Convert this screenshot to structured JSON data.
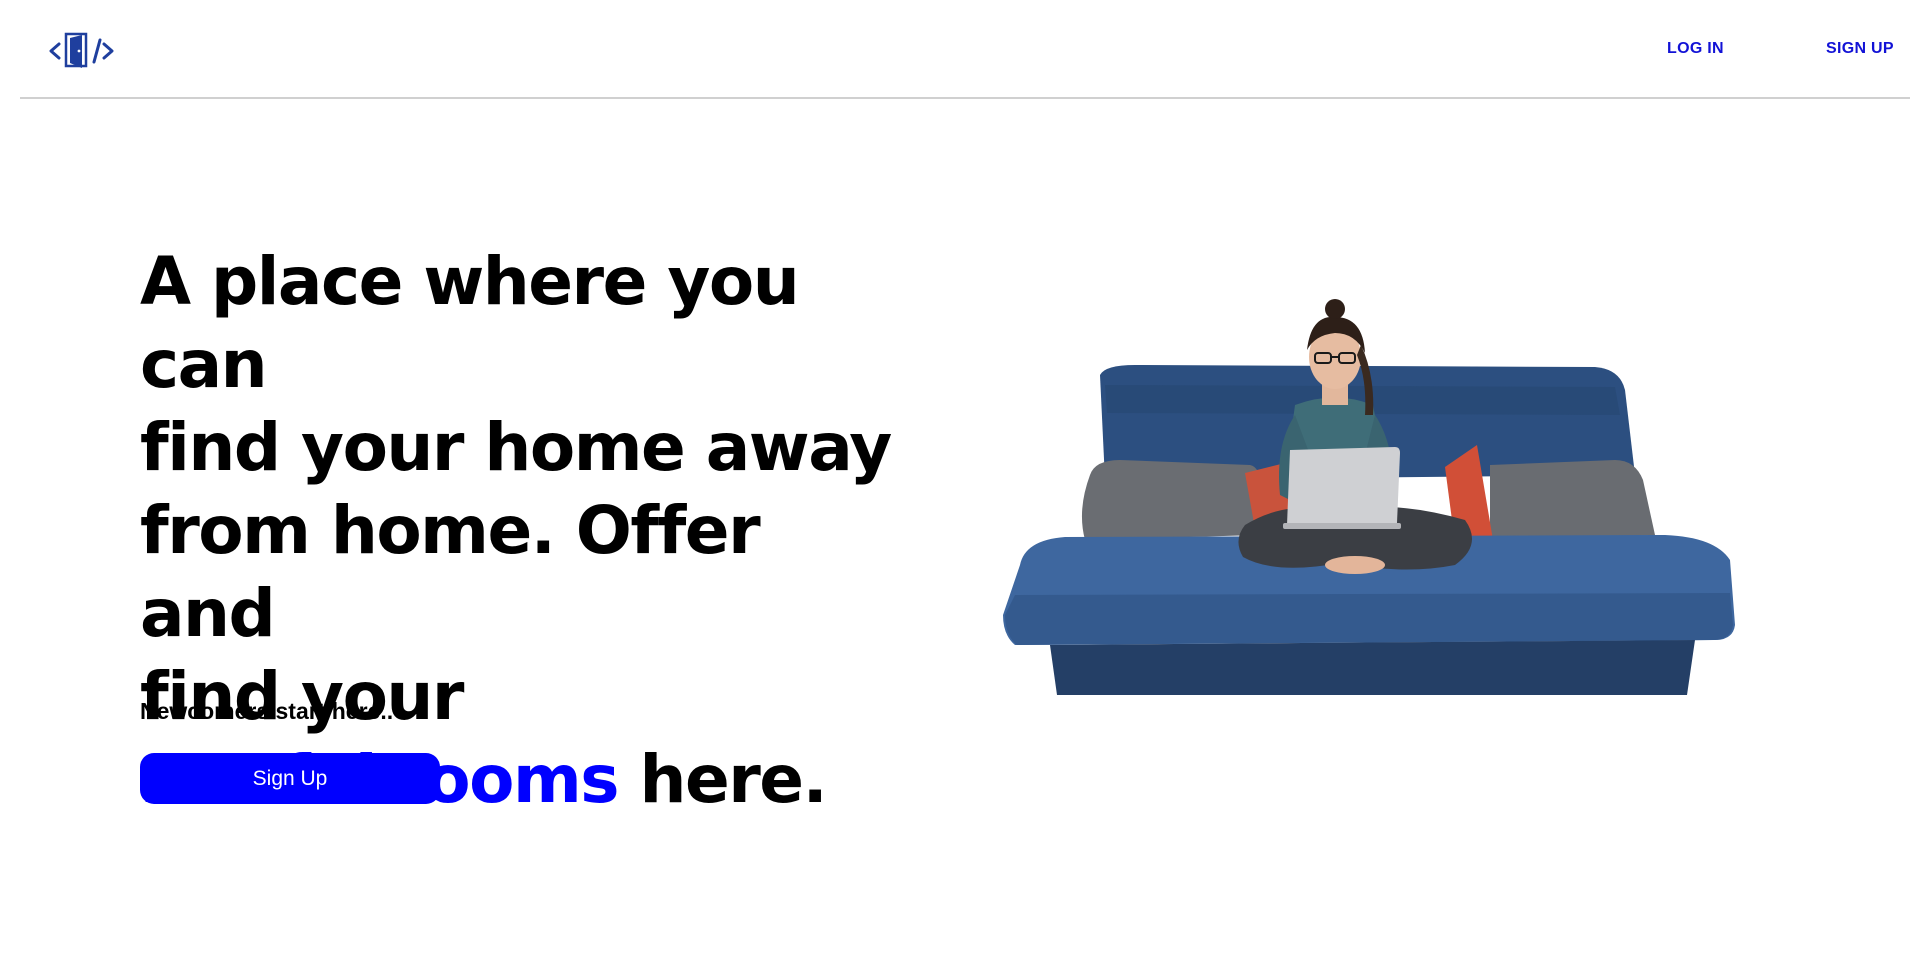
{
  "header": {
    "logo_alt": "restfulRooms logo",
    "nav": {
      "login_label": "LOG IN",
      "signup_label": "SIGN UP"
    }
  },
  "hero": {
    "title_line1": "A place where you can",
    "title_line2": "find your home away",
    "title_line3": "from home. Offer and",
    "title_line4": "find your",
    "brand_name": "restfulRooms",
    "title_suffix": " here.",
    "subhead": "Newcomers start here..",
    "cta_label": "Sign Up",
    "image_alt": "woman with laptop sitting on blue sofa"
  },
  "colors": {
    "accent": "#0000ff",
    "nav_link": "#1212d6",
    "logo": "#1f3f9e",
    "sofa": "#2f5488"
  }
}
